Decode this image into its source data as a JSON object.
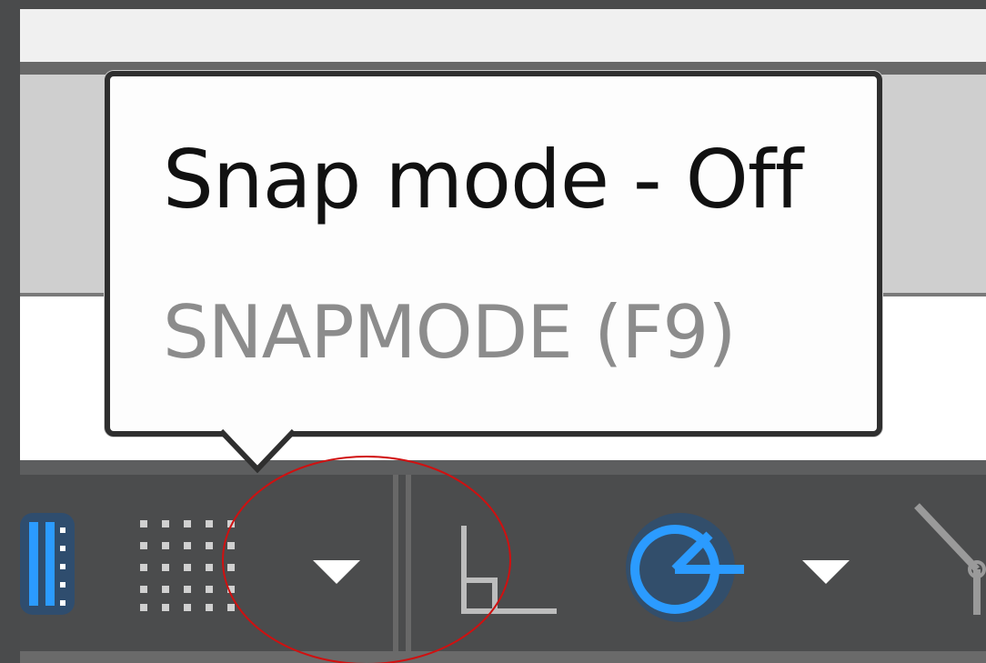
{
  "tooltip": {
    "title": "Snap mode - Off",
    "command": "SNAPMODE (F9)"
  },
  "statusbar": {
    "buttons": [
      {
        "name": "grid-display-icon",
        "state": "on"
      },
      {
        "name": "snap-mode-icon",
        "state": "off"
      },
      {
        "name": "snap-mode-dropdown",
        "icon": "chevron-down-icon"
      },
      {
        "name": "ortho-mode-icon",
        "state": "off"
      },
      {
        "name": "polar-tracking-icon",
        "state": "on"
      },
      {
        "name": "polar-tracking-dropdown",
        "icon": "chevron-down-icon"
      },
      {
        "name": "isometric-drafting-icon",
        "state": "off"
      }
    ]
  },
  "colors": {
    "statusbar_bg": "#4b4c4d",
    "active_blue": "#1e90ff",
    "inactive_gray": "#c8c8c8",
    "tooltip_bg": "#fdfdfd",
    "tooltip_title": "#111111",
    "tooltip_command": "#8c8c8c",
    "annotation_red": "#d01010"
  }
}
